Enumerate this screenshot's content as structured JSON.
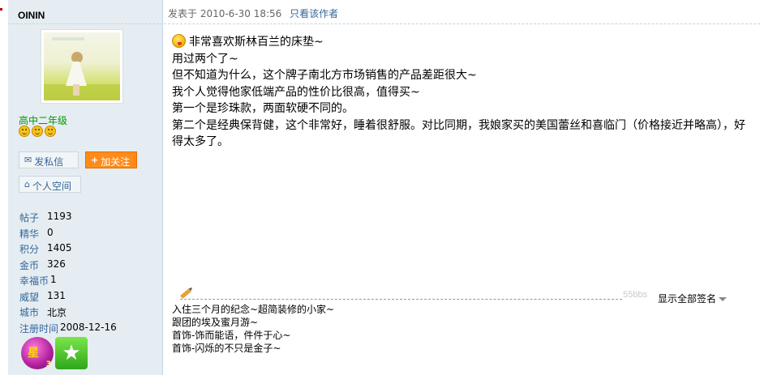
{
  "user": {
    "name": "OININ",
    "rank": "高中二年级",
    "rank_icons": [
      "smile-icon",
      "smile-icon",
      "smile-icon"
    ],
    "buttons": {
      "pm": "发私信",
      "follow": "加关注",
      "space": "个人空间"
    },
    "stats": [
      {
        "label": "帖子",
        "value": "1193"
      },
      {
        "label": "精华",
        "value": "0"
      },
      {
        "label": "积分",
        "value": "1405"
      },
      {
        "label": "金币",
        "value": "326"
      },
      {
        "label": "幸福币",
        "value": "1"
      },
      {
        "label": "威望",
        "value": "131"
      },
      {
        "label": "城市",
        "value": "北京"
      },
      {
        "label": "注册时间",
        "value": "2008-12-16"
      }
    ],
    "medals": [
      {
        "icon": "star-medal-icon",
        "text": "星",
        "count": "3"
      },
      {
        "icon": "green-star-medal-icon"
      }
    ]
  },
  "post": {
    "time": "发表于 2010-6-30 18:56",
    "only_author": "只看该作者",
    "lines": [
      "非常喜欢斯林百兰的床垫~",
      "用过两个了~",
      "但不知道为什么，这个牌子南北方市场销售的产品差距很大~",
      "我个人觉得他家低端产品的性价比很高，值得买~",
      "第一个是珍珠款，两面软硬不同的。",
      "第二个是经典保背健，这个非常好，睡着很舒服。对比同期，我娘家买的美国蕾丝和喜临门（价格接近并略高），好",
      "得太多了。"
    ]
  },
  "signature": {
    "watermark": "55bbs",
    "show_all": "显示全部签名",
    "lines": [
      "入住三个月的纪念~超简装修的小家~",
      "跟团的埃及蜜月游~",
      "首饰-饰而能语，件件于心~",
      "首饰-闪烁的不只是金子~"
    ]
  },
  "colors": {
    "sidebar_bg": "#e5edf2",
    "link": "#336699",
    "rank": "#009900",
    "follow_btn": "#ff8c1a"
  }
}
